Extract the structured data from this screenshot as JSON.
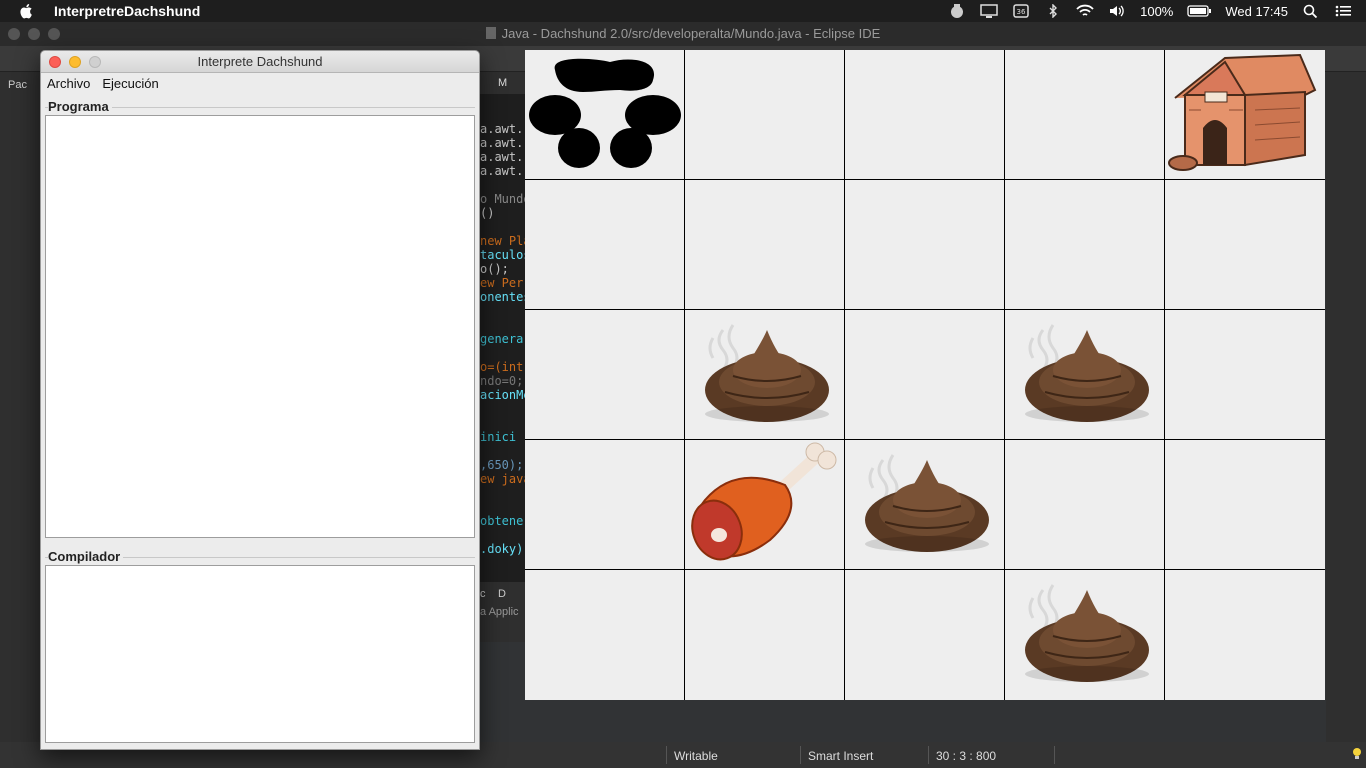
{
  "menubar": {
    "app_name": "InterpretreDachshund",
    "battery": "100%",
    "clock": "Wed 17:45"
  },
  "eclipse": {
    "title": "Java - Dachshund 2.0/src/developeralta/Mundo.java - Eclipse IDE",
    "left_tab": "Pac",
    "editor_tab": "M",
    "code_lines": [
      {
        "text": "a.awt.",
        "color": "#c8c8c8"
      },
      {
        "text": "a.awt.",
        "color": "#c8c8c8"
      },
      {
        "text": "a.awt.",
        "color": "#c8c8c8"
      },
      {
        "text": "a.awt.",
        "color": "#c8c8c8"
      },
      {
        "text": "o Mundo",
        "color": "#888888"
      },
      {
        "text": "()",
        "color": "#c8c8c8"
      },
      {
        "text": "new Pla",
        "color": "#cc6c1d"
      },
      {
        "text": "taculos",
        "color": "#66e1f8"
      },
      {
        "text": "o();",
        "color": "#c8c8c8"
      },
      {
        "text": "ew Per",
        "color": "#cc6c1d"
      },
      {
        "text": "onentes",
        "color": "#66e1f8"
      },
      {
        "text": "genera",
        "color": "#3ec1d3"
      },
      {
        "text": "o=(int",
        "color": "#cc6c1d"
      },
      {
        "text": "ndo=0;",
        "color": "#777777"
      },
      {
        "text": "acionMe",
        "color": "#66e1f8"
      },
      {
        "text": " inici",
        "color": "#3ec1d3"
      },
      {
        "text": ",650);",
        "color": "#6897bb"
      },
      {
        "text": "ew java",
        "color": "#cc6c1d"
      },
      {
        "text": " obtene",
        "color": "#3ec1d3"
      },
      {
        "text": ".doky)",
        "color": "#66e1f8"
      }
    ],
    "console_tab_1": "c",
    "console_tab_2": "D",
    "console_text": "a Applic",
    "status": {
      "writable": "Writable",
      "insert_mode": "Smart Insert",
      "position": "30 : 3 : 800"
    }
  },
  "interprete": {
    "title": "Interprete Dachshund",
    "menu": [
      "Archivo",
      "Ejecución"
    ],
    "programa_label": "Programa",
    "compilador_label": "Compilador",
    "programa_text": "",
    "compilador_text": ""
  },
  "board": {
    "rows": 5,
    "cols": 5,
    "cells": [
      {
        "row": 0,
        "col": 0,
        "item": "paw-print"
      },
      {
        "row": 0,
        "col": 4,
        "item": "doghouse"
      },
      {
        "row": 2,
        "col": 1,
        "item": "poop"
      },
      {
        "row": 2,
        "col": 3,
        "item": "poop"
      },
      {
        "row": 3,
        "col": 1,
        "item": "meat-leg"
      },
      {
        "row": 3,
        "col": 2,
        "item": "poop"
      },
      {
        "row": 4,
        "col": 3,
        "item": "poop"
      }
    ]
  }
}
